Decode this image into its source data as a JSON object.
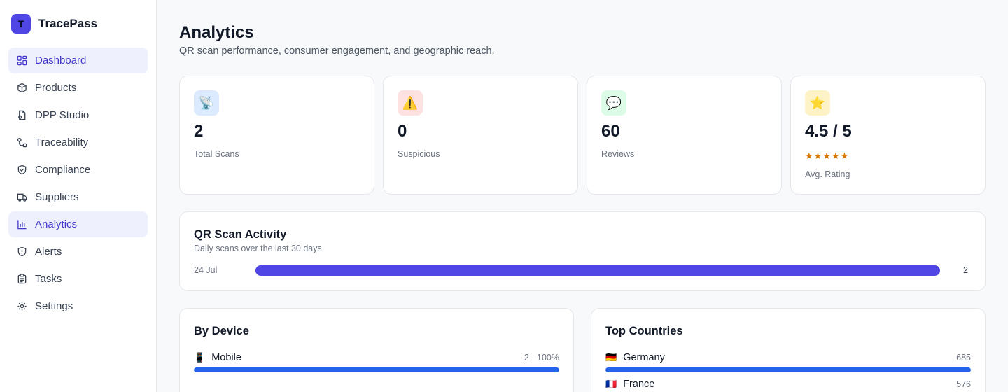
{
  "app": {
    "name": "TracePass",
    "logo_letter": "T",
    "accent": "#4f46e5"
  },
  "sidebar": {
    "items": [
      {
        "label": "Dashboard",
        "icon": "dashboard-icon",
        "active": true
      },
      {
        "label": "Products",
        "icon": "box-icon",
        "active": false
      },
      {
        "label": "DPP Studio",
        "icon": "file-icon",
        "active": false
      },
      {
        "label": "Traceability",
        "icon": "route-icon",
        "active": false
      },
      {
        "label": "Compliance",
        "icon": "shield-check-icon",
        "active": false
      },
      {
        "label": "Suppliers",
        "icon": "truck-icon",
        "active": false
      },
      {
        "label": "Analytics",
        "icon": "bar-chart-icon",
        "active": true
      },
      {
        "label": "Alerts",
        "icon": "alert-shield-icon",
        "active": false
      },
      {
        "label": "Tasks",
        "icon": "clipboard-icon",
        "active": false
      },
      {
        "label": "Settings",
        "icon": "gear-icon",
        "active": false
      }
    ]
  },
  "page": {
    "title": "Analytics",
    "subtitle": "QR scan performance, consumer engagement, and geographic reach."
  },
  "stats": [
    {
      "icon": "📡",
      "icon_name": "satellite-icon",
      "icon_bg": "#dbeafe",
      "value": "2",
      "label": "Total Scans"
    },
    {
      "icon": "⚠️",
      "icon_name": "warning-icon",
      "icon_bg": "#fee2e2",
      "value": "0",
      "label": "Suspicious"
    },
    {
      "icon": "💬",
      "icon_name": "speech-bubble-icon",
      "icon_bg": "#dcfce7",
      "value": "60",
      "label": "Reviews"
    },
    {
      "icon": "⭐",
      "icon_name": "star-icon",
      "icon_bg": "#fef3c7",
      "value": "4.5 / 5",
      "stars": "★★★★★",
      "label": "Avg. Rating"
    }
  ],
  "activity": {
    "title": "QR Scan Activity",
    "subtitle": "Daily scans over the last 30 days",
    "rows": [
      {
        "date": "24 Jul",
        "count": "2",
        "fraction": 1.0
      }
    ]
  },
  "devices": {
    "title": "By Device",
    "rows": [
      {
        "icon": "📱",
        "icon_name": "mobile-phone-icon",
        "label": "Mobile",
        "value": "2 · 100%",
        "fraction": 1.0
      }
    ]
  },
  "countries": {
    "title": "Top Countries",
    "rows": [
      {
        "flag": "🇩🇪",
        "label": "Germany",
        "value": "685",
        "fraction": 1.0
      },
      {
        "flag": "🇫🇷",
        "label": "France",
        "value": "576",
        "fraction": 0.84
      }
    ]
  }
}
